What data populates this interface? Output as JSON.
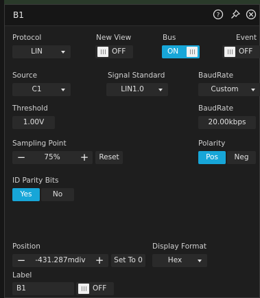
{
  "window": {
    "title": "B1"
  },
  "titlebar_icons": [
    "help-icon",
    "pin-icon",
    "close-icon"
  ],
  "protocol": {
    "label": "Protocol",
    "value": "LIN"
  },
  "new_view": {
    "label": "New View",
    "state": "OFF"
  },
  "bus": {
    "label": "Bus",
    "state": "ON"
  },
  "event": {
    "label": "Event",
    "state": "OFF"
  },
  "source": {
    "label": "Source",
    "value": "C1"
  },
  "signal_standard": {
    "label": "Signal Standard",
    "value": "LIN1.0"
  },
  "baudrate_select": {
    "label": "BaudRate",
    "value": "Custom"
  },
  "threshold": {
    "label": "Threshold",
    "value": "1.00V"
  },
  "baudrate_value": {
    "label": "BaudRate",
    "value": "20.00kbps"
  },
  "sampling_point": {
    "label": "Sampling Point",
    "value": "75%",
    "reset_label": "Reset"
  },
  "polarity": {
    "label": "Polarity",
    "options": [
      "Pos",
      "Neg"
    ],
    "selected": "Pos"
  },
  "id_parity": {
    "label": "ID Parity Bits",
    "options": [
      "Yes",
      "No"
    ],
    "selected": "Yes"
  },
  "position": {
    "label": "Position",
    "value": "-431.287mdiv",
    "set_zero_label": "Set To 0"
  },
  "display_format": {
    "label": "Display Format",
    "value": "Hex"
  },
  "label_field": {
    "label": "Label",
    "value": "B1",
    "state": "OFF"
  },
  "colors": {
    "accent": "#17a6d8",
    "panel": "#1e1e1e",
    "field": "#2a2a2a"
  }
}
